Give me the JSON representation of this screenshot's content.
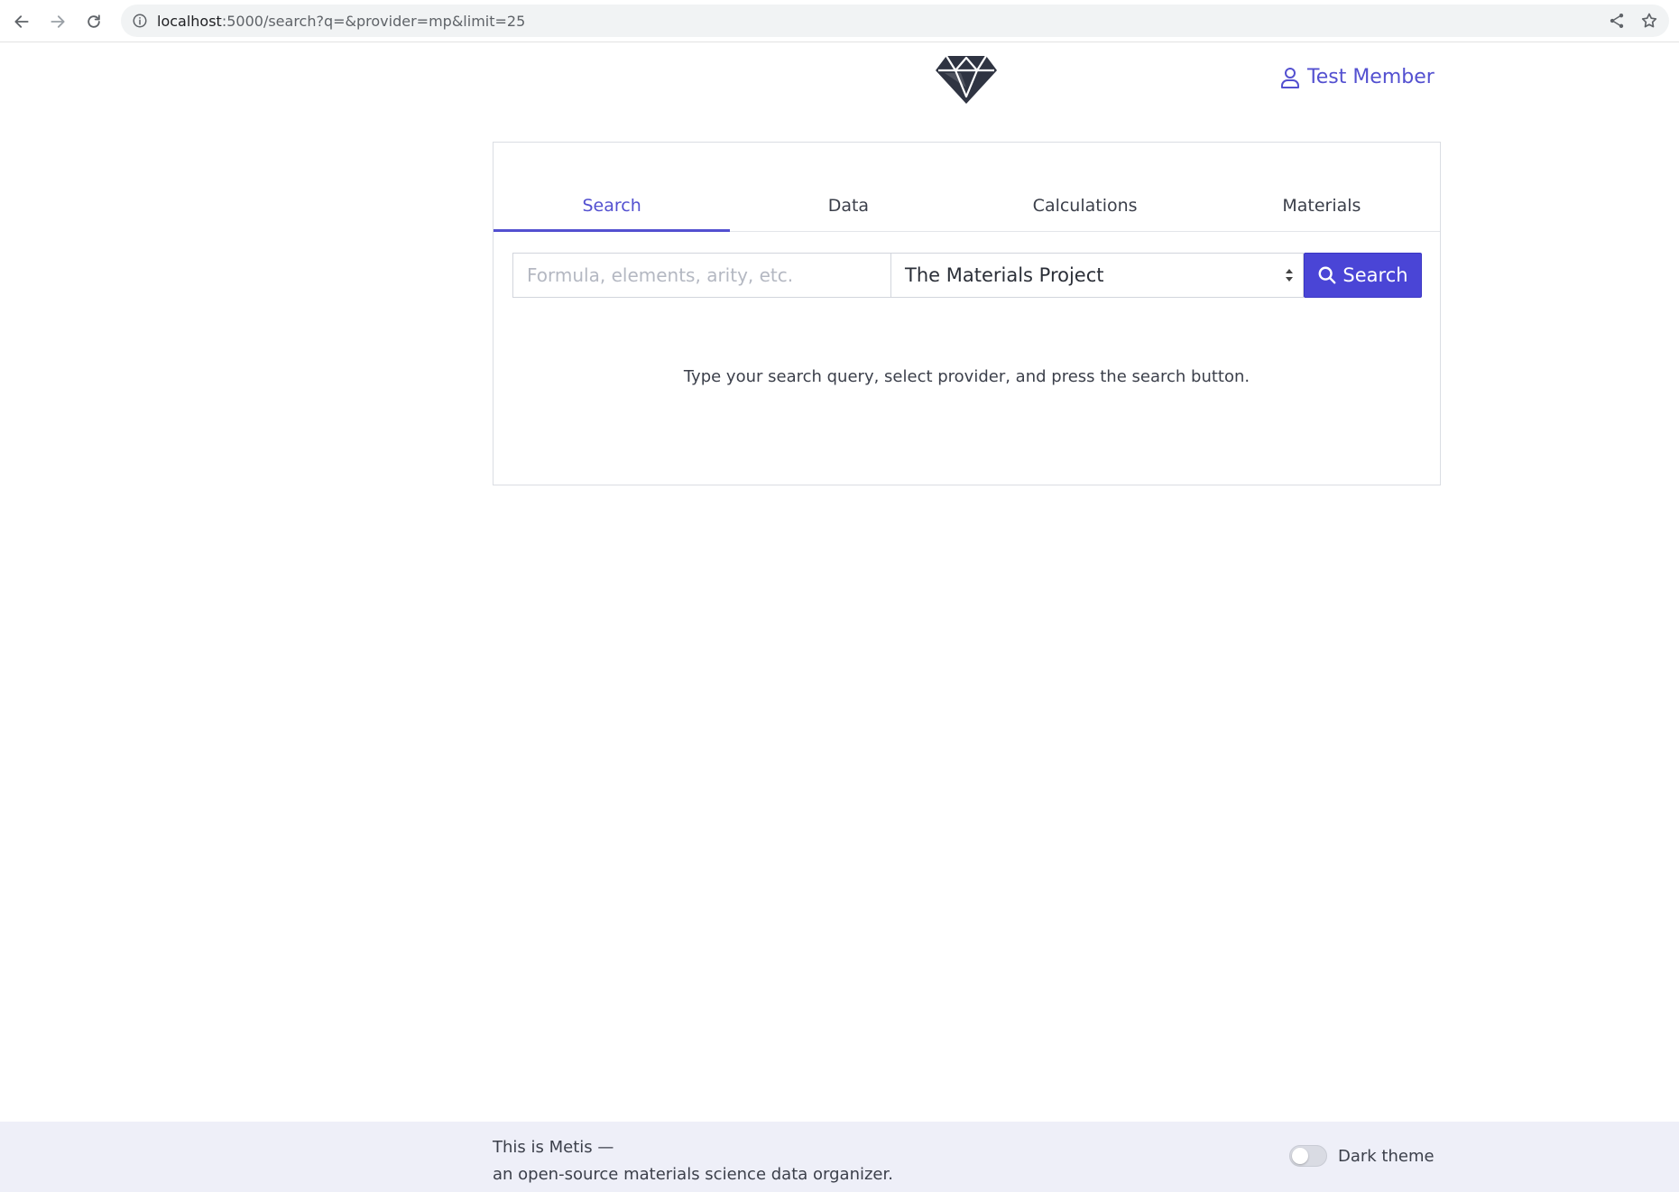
{
  "browser": {
    "url_host": "localhost",
    "url_rest": ":5000/search?q=&provider=mp&limit=25"
  },
  "header": {
    "logo_icon": "diamond-icon",
    "user_name": "Test Member",
    "accent_color": "#5350d0"
  },
  "tabs": [
    {
      "label": "Search",
      "active": true
    },
    {
      "label": "Data",
      "active": false
    },
    {
      "label": "Calculations",
      "active": false
    },
    {
      "label": "Materials",
      "active": false
    }
  ],
  "search": {
    "placeholder": "Formula, elements, arity, etc.",
    "value": "",
    "provider": "The Materials Project",
    "button_label": "Search"
  },
  "hint": "Type your search query, select provider, and press the search button.",
  "footer": {
    "line1": "This is Metis —",
    "line2": "an open-source materials science data organizer.",
    "dark_theme_label": "Dark theme",
    "dark_theme_on": false
  }
}
